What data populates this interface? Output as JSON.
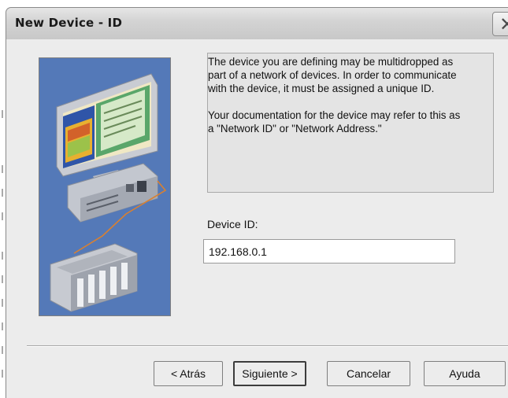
{
  "window": {
    "title": "New Device - ID",
    "close_glyph": "✕"
  },
  "description": {
    "paragraph1": [
      "The device you are defining may be multidropped as",
      "part of a network of devices.  In order to communicate",
      "with the device, it must be assigned a unique ID."
    ],
    "paragraph2": [
      "Your documentation for the device may refer to this as",
      "a \"Network ID\" or \"Network Address.\""
    ]
  },
  "device_id": {
    "label": "Device ID:",
    "value": "192.168.0.1"
  },
  "buttons": {
    "back": "< Atrás",
    "next": "Siguiente >",
    "cancel": "Cancelar",
    "help": "Ayuda"
  },
  "illustration": {
    "name": "device-network-illustration",
    "background_color": "#4f77b6"
  },
  "colors": {
    "dialog_bg": "#ececec",
    "title_bar": "#d4d4d4"
  }
}
